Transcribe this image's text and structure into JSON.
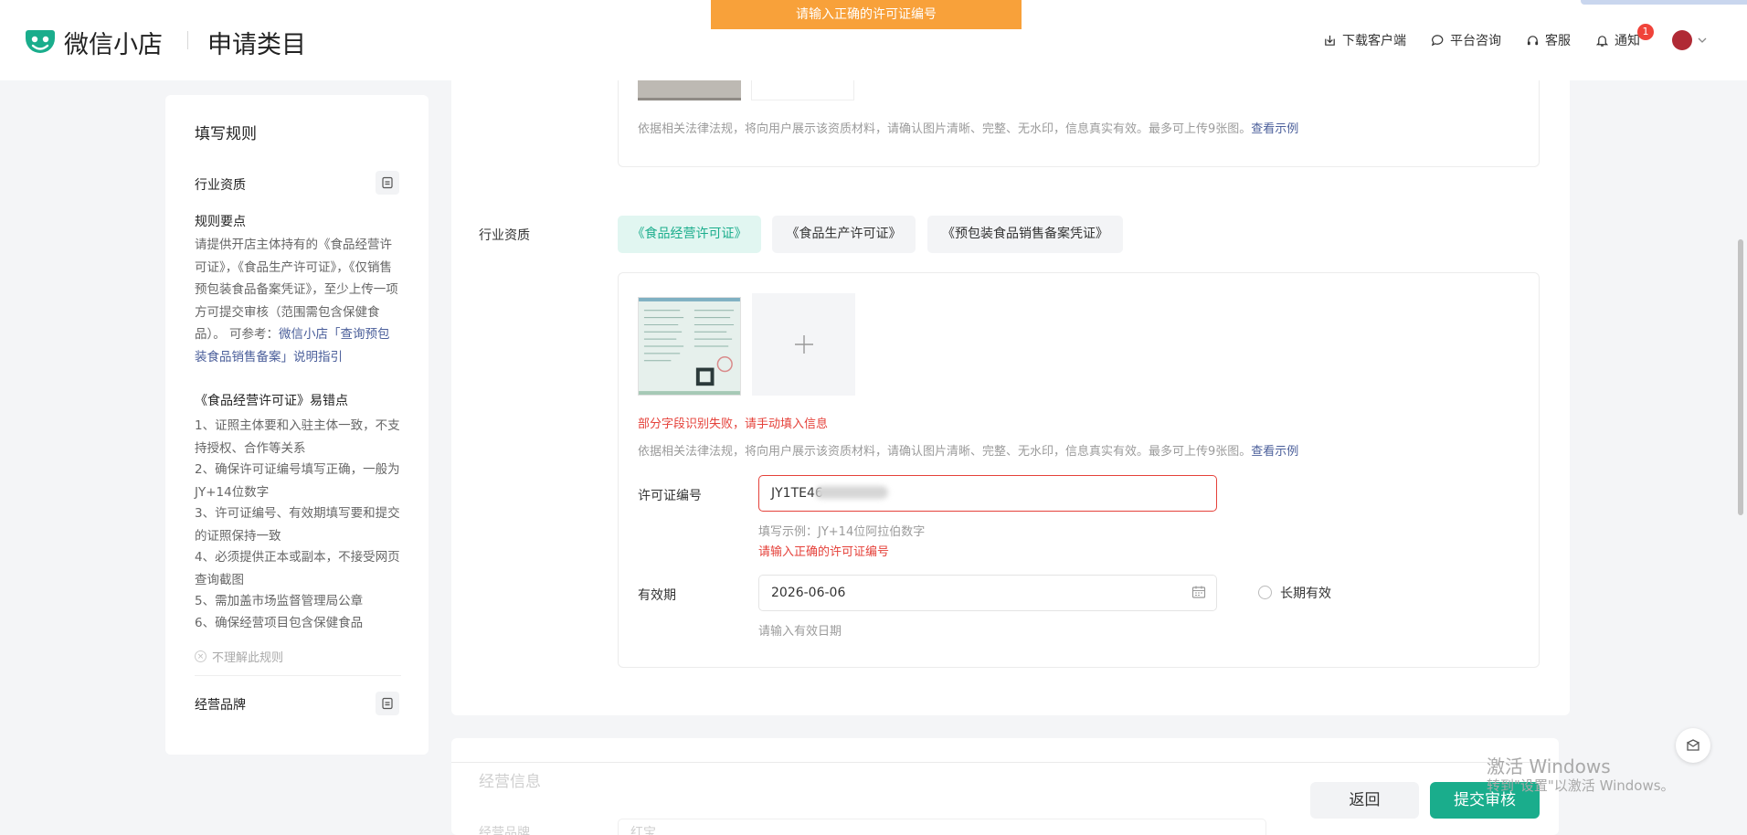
{
  "header": {
    "brand": "微信小店",
    "page_title": "申请类目",
    "toast": "请输入正确的许可证编号",
    "nav": {
      "download": "下载客户端",
      "consult": "平台咨询",
      "service": "客服",
      "notify": "通知",
      "notify_count": "1"
    }
  },
  "sidebar": {
    "title": "填写规则",
    "section1": "行业资质",
    "rules_heading": "规则要点",
    "rules_text": "请提供开店主体持有的《食品经营许可证》，《食品生产许可证》，《仅销售预包装食品备案凭证》，至少上传一项方可提交审核（范围需包含保健食品）。 可参考：",
    "rules_link": "微信小店「查询预包装食品销售备案」说明指引",
    "pitfalls_heading": "《食品经营许可证》易错点",
    "pitfalls": [
      "1、证照主体要和入驻主体一致，不支持授权、合作等关系",
      "2、确保许可证编号填写正确，一般为JY+14位数字",
      "3、许可证编号、有效期填写要和提交的证照保持一致",
      "4、必须提供正本或副本，不接受网页查询截图",
      "5、需加盖市场监督管理局公章",
      "6、确保经营项目包含保健食品"
    ],
    "not_understand": "不理解此规则",
    "section2": "经营品牌"
  },
  "form": {
    "desc_text": "依据相关法律法规，将向用户展示该资质材料，请确认图片清晰、完整、无水印，信息真实有效。最多可上传9张图。",
    "desc_link": "查看示例",
    "qual_label": "行业资质",
    "chips": [
      "《食品经营许可证》",
      "《食品生产许可证》",
      "《预包装食品销售备案凭证》"
    ],
    "ocr_error": "部分字段识别失败，请手动填入信息",
    "license_label": "许可证编号",
    "license_value": "JY1TE46",
    "license_hint": "填写示例：JY+14位阿拉伯数字",
    "license_error": "请输入正确的许可证编号",
    "validity_label": "有效期",
    "validity_value": "2026-06-06",
    "longterm_label": "长期有效",
    "validity_hint": "请输入有效日期"
  },
  "section_next": {
    "title": "经营信息",
    "brand_label": "经营品牌",
    "brand_value": "红宝"
  },
  "actions": {
    "back": "返回",
    "submit": "提交审核"
  },
  "watermark": {
    "line1": "激活 Windows",
    "line2": "转到\"设置\"以激活 Windows。"
  },
  "colors": {
    "accent": "#1aad8c",
    "error": "#e5413a",
    "toast": "#f8a13a",
    "link": "#4a5e9a"
  }
}
